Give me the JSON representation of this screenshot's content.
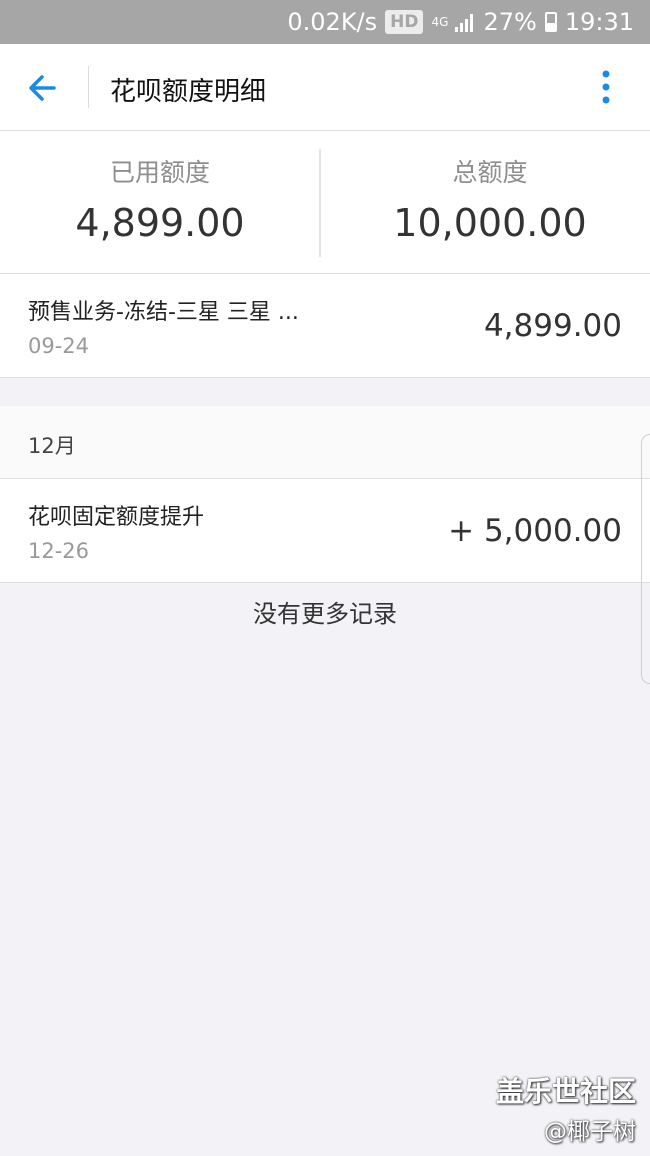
{
  "status_bar": {
    "speed": "0.02K/s",
    "hd": "HD",
    "network": "4G",
    "battery": "27%",
    "time": "19:31"
  },
  "appbar": {
    "title": "花呗额度明细",
    "back_icon": "arrow-left-icon",
    "more_icon": "more-vert-icon",
    "accent": "#1a8be0"
  },
  "summary": {
    "used_label": "已用额度",
    "used_value": "4,899.00",
    "total_label": "总额度",
    "total_value": "10,000.00"
  },
  "records": [
    {
      "title": "预售业务-冻结-三星 三星 ...",
      "date": "09-24",
      "amount": "4,899.00"
    }
  ],
  "month_section": {
    "label": "12月",
    "records": [
      {
        "title": "花呗固定额度提升",
        "date": "12-26",
        "amount": "+ 5,000.00"
      }
    ]
  },
  "footer": {
    "no_more": "没有更多记录"
  },
  "watermark": {
    "line1": "盖乐世社区",
    "line2": "@椰子树"
  }
}
